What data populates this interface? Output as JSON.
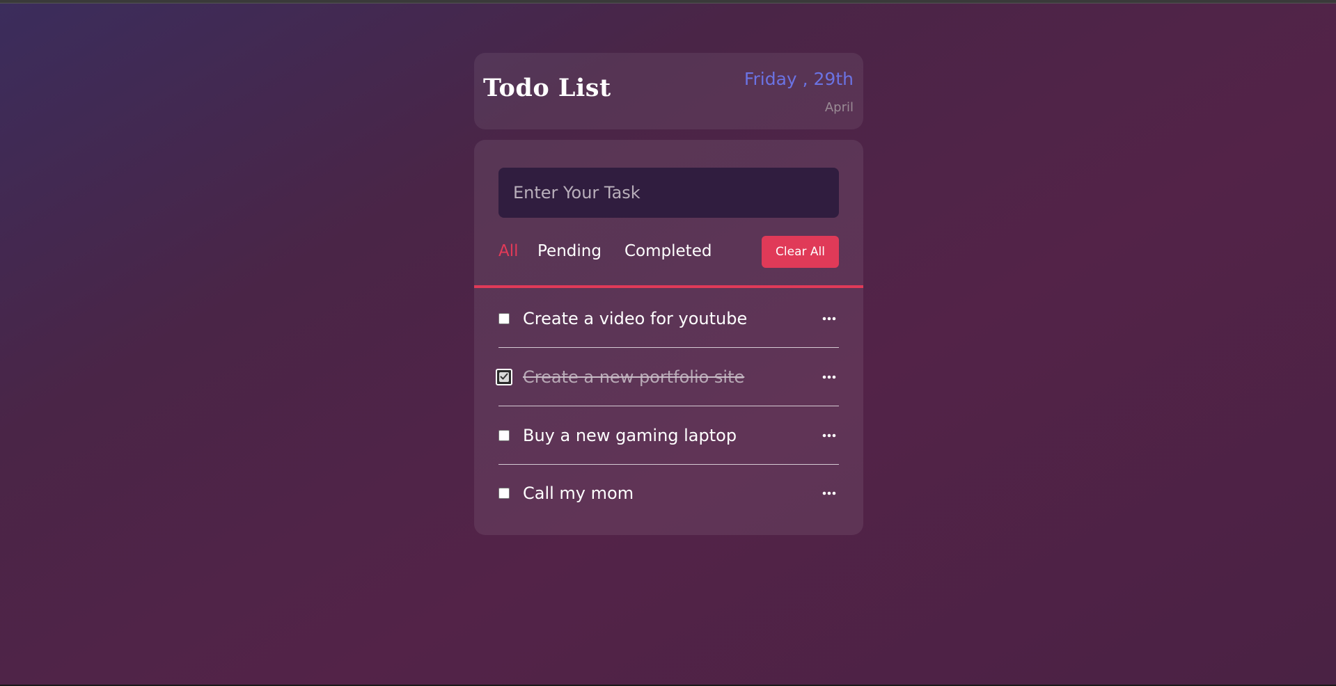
{
  "header": {
    "title": "Todo List",
    "date_day": "Friday , 29th",
    "date_month": "April"
  },
  "input": {
    "placeholder": "Enter Your Task",
    "value": ""
  },
  "filters": [
    {
      "label": "All",
      "active": true
    },
    {
      "label": "Pending",
      "active": false
    },
    {
      "label": "Completed",
      "active": false
    }
  ],
  "clear_label": "Clear All",
  "tasks": [
    {
      "text": "Create a video for youtube",
      "completed": false
    },
    {
      "text": "Create a new portfolio site",
      "completed": true
    },
    {
      "text": "Buy a new gaming laptop",
      "completed": false
    },
    {
      "text": "Call my mom",
      "completed": false
    }
  ],
  "colors": {
    "accent": "#e03a58",
    "date_color": "#6b73e3",
    "input_bg": "#301d3f"
  },
  "icons": {
    "task_menu": "ellipsis-icon",
    "checkbox_checked": "checkmark-icon"
  }
}
